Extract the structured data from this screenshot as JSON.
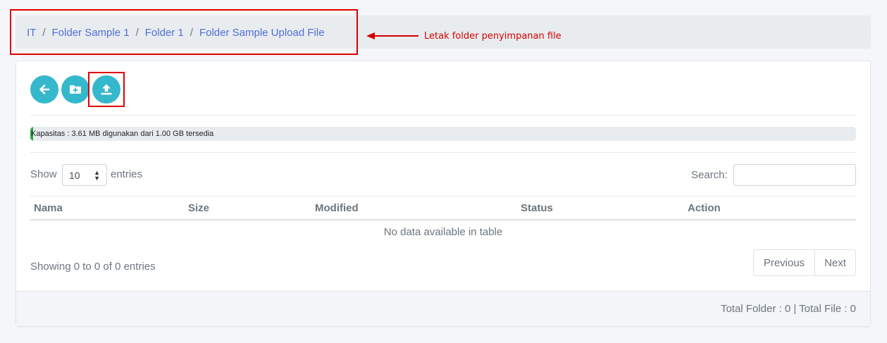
{
  "breadcrumb": {
    "items": [
      {
        "label": "IT"
      },
      {
        "label": "Folder Sample 1"
      },
      {
        "label": "Folder 1"
      },
      {
        "label": "Folder Sample Upload File"
      }
    ],
    "separator": "/"
  },
  "annotation": {
    "text": "Letak folder penyimpanan file",
    "color": "#d60000"
  },
  "toolbar": {
    "buttons": [
      {
        "icon": "arrow-left-icon"
      },
      {
        "icon": "folder-plus-icon"
      },
      {
        "icon": "upload-icon"
      }
    ],
    "accent": "#35b8cc"
  },
  "storage": {
    "label": "Kapasitas : 3.61 MB digunakan dari 1.00 GB tersedia",
    "used_fraction": 0.0035,
    "bar_color": "#28a745"
  },
  "table": {
    "show_label": "Show",
    "length_value": "10",
    "entries_label": "entries",
    "search_label": "Search:",
    "columns": [
      "Nama",
      "Size",
      "Modified",
      "Status",
      "Action"
    ],
    "empty_message": "No data available in table",
    "info": "Showing 0 to 0 of 0 entries",
    "pagination": {
      "previous": "Previous",
      "next": "Next"
    }
  },
  "footer": {
    "summary": "Total Folder : 0 | Total File : 0"
  }
}
